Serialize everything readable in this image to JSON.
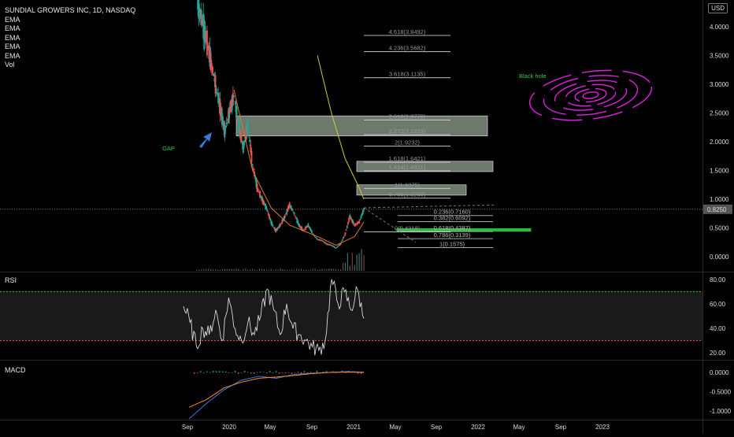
{
  "header": {
    "symbol_title": "SUNDIAL GROWERS INC, 1D, NASDAQ",
    "indicators": [
      "EMA",
      "EMA",
      "EMA",
      "EMA",
      "EMA",
      "Vol"
    ],
    "currency_button": "USD"
  },
  "panels": {
    "rsi_label": "RSI",
    "macd_label": "MACD"
  },
  "annotations": {
    "gap_label": "GAP",
    "black_hole_label": "Black hole",
    "last_price_tag": "0.8250"
  },
  "colors": {
    "background": "#000000",
    "candle_up": "#26a69a",
    "candle_down": "#ef5350",
    "ema_slow": "#cccc33",
    "ema_fast": "#e07a2e",
    "rsi_line": "#d8d8d8",
    "macd_line": "#3b6fd6",
    "signal_line": "#ff8c2a",
    "fib_line": "#cfcfcf",
    "zone_fill": "#c8dcc8",
    "green_zone": "#2ecc40",
    "spiral": "#e020e0",
    "arrow": "#3a7bd5"
  },
  "chart_data": [
    {
      "type": "candlestick",
      "title": "SUNDIAL GROWERS INC, 1D, NASDAQ",
      "x_ticks": [
        "Sep",
        "2020",
        "May",
        "Sep",
        "2021",
        "May",
        "Sep",
        "2022",
        "May",
        "Sep",
        "2023"
      ],
      "y_ticks": [
        "4.0000",
        "3.5000",
        "3.0000",
        "2.5000",
        "2.0000",
        "1.5000",
        "1.0000",
        "0.5000",
        "0.0000"
      ],
      "ylim": [
        -0.1,
        4.5
      ],
      "close_series": [
        {
          "t": 0.0,
          "v": 4.5
        },
        {
          "t": 1.0,
          "v": 3.8
        },
        {
          "t": 2.0,
          "v": 3.0
        },
        {
          "t": 3.0,
          "v": 2.2
        },
        {
          "t": 3.5,
          "v": 2.5
        },
        {
          "t": 4.0,
          "v": 2.8
        },
        {
          "t": 4.5,
          "v": 2.3
        },
        {
          "t": 5.0,
          "v": 1.9
        },
        {
          "t": 5.5,
          "v": 2.3
        },
        {
          "t": 6.0,
          "v": 1.6
        },
        {
          "t": 6.5,
          "v": 1.2
        },
        {
          "t": 7.0,
          "v": 1.0
        },
        {
          "t": 7.5,
          "v": 0.85
        },
        {
          "t": 8.0,
          "v": 0.6
        },
        {
          "t": 8.5,
          "v": 0.45
        },
        {
          "t": 9.0,
          "v": 0.55
        },
        {
          "t": 9.5,
          "v": 0.7
        },
        {
          "t": 10.0,
          "v": 0.9
        },
        {
          "t": 10.5,
          "v": 0.75
        },
        {
          "t": 11.0,
          "v": 0.55
        },
        {
          "t": 11.5,
          "v": 0.45
        },
        {
          "t": 12.0,
          "v": 0.55
        },
        {
          "t": 12.5,
          "v": 0.4
        },
        {
          "t": 13.0,
          "v": 0.3
        },
        {
          "t": 13.5,
          "v": 0.28
        },
        {
          "t": 14.0,
          "v": 0.22
        },
        {
          "t": 14.5,
          "v": 0.2
        },
        {
          "t": 15.0,
          "v": 0.15
        },
        {
          "t": 15.5,
          "v": 0.22
        },
        {
          "t": 16.0,
          "v": 0.4
        },
        {
          "t": 16.5,
          "v": 0.7
        },
        {
          "t": 17.0,
          "v": 0.55
        },
        {
          "t": 17.5,
          "v": 0.6
        },
        {
          "t": 18.0,
          "v": 0.825
        }
      ],
      "ema_slow": [
        {
          "t": 4.0,
          "v": 2.9
        },
        {
          "t": 6.0,
          "v": 1.5
        },
        {
          "t": 8.0,
          "v": 0.85
        },
        {
          "t": 10.0,
          "v": 0.55
        },
        {
          "t": 13.0,
          "v": 0.35
        },
        {
          "t": 15.0,
          "v": 0.2
        },
        {
          "t": 17.0,
          "v": 0.35
        },
        {
          "t": 18.0,
          "v": 0.6
        }
      ],
      "ema_projection": [
        {
          "t": 13.0,
          "v": 3.5
        },
        {
          "t": 14.5,
          "v": 2.5
        },
        {
          "t": 16.0,
          "v": 1.7
        },
        {
          "t": 17.5,
          "v": 1.2
        },
        {
          "t": 18.0,
          "v": 1.0
        }
      ],
      "fib_extension_levels": [
        {
          "label": "4.618(3.8492)",
          "value": 3.8492
        },
        {
          "label": "4.236(3.5682)",
          "value": 3.5682
        },
        {
          "label": "3.618(3.1135)",
          "value": 3.1135
        },
        {
          "label": "2.618(2.3778)",
          "value": 2.3778
        },
        {
          "label": "2.272(2.1233)",
          "value": 2.1233
        },
        {
          "label": "2(1.9232)",
          "value": 1.9232
        },
        {
          "label": "1.618(1.6421)",
          "value": 1.6421
        },
        {
          "label": "1.414(1.4921)",
          "value": 1.4921
        },
        {
          "label": "1(1.1875)",
          "value": 1.1875
        },
        {
          "label": "0.786(1.0200)",
          "value": 1.02
        },
        {
          "label": "0(0.4318)",
          "value": 0.4318
        }
      ],
      "fib_retracement_levels": [
        {
          "label": "0.236(0.7160)",
          "value": 0.716
        },
        {
          "label": "0.382(0.6092)",
          "value": 0.6092
        },
        {
          "label": "0.618(0.4387)",
          "value": 0.4387
        },
        {
          "label": "0.786(0.3139)",
          "value": 0.3139
        },
        {
          "label": "1(0.1575)",
          "value": 0.1575
        }
      ],
      "zones": [
        {
          "y_low": 2.1,
          "y_high": 2.45
        },
        {
          "y_low": 1.48,
          "y_high": 1.66
        },
        {
          "y_low": 1.07,
          "y_high": 1.25
        },
        {
          "y_low": 0.44,
          "y_high": 0.49
        }
      ],
      "last_price": 0.825
    },
    {
      "type": "line",
      "title": "RSI",
      "y_ticks": [
        "80.00",
        "60.00",
        "40.00",
        "20.00"
      ],
      "ylim": [
        15,
        85
      ],
      "bands": [
        70,
        30
      ],
      "values": [
        {
          "t": 0,
          "v": 58
        },
        {
          "t": 1,
          "v": 45
        },
        {
          "t": 2,
          "v": 25
        },
        {
          "t": 3,
          "v": 40
        },
        {
          "t": 4,
          "v": 35
        },
        {
          "t": 5,
          "v": 55
        },
        {
          "t": 6,
          "v": 30
        },
        {
          "t": 7,
          "v": 65
        },
        {
          "t": 8,
          "v": 40
        },
        {
          "t": 9,
          "v": 30
        },
        {
          "t": 10,
          "v": 45
        },
        {
          "t": 11,
          "v": 35
        },
        {
          "t": 12,
          "v": 50
        },
        {
          "t": 13,
          "v": 72
        },
        {
          "t": 14,
          "v": 55
        },
        {
          "t": 15,
          "v": 35
        },
        {
          "t": 16,
          "v": 60
        },
        {
          "t": 17,
          "v": 40
        },
        {
          "t": 18,
          "v": 35
        },
        {
          "t": 19,
          "v": 30
        },
        {
          "t": 20,
          "v": 25
        },
        {
          "t": 21,
          "v": 22
        },
        {
          "t": 22,
          "v": 30
        },
        {
          "t": 23,
          "v": 80
        },
        {
          "t": 24,
          "v": 60
        },
        {
          "t": 25,
          "v": 70
        },
        {
          "t": 26,
          "v": 55
        },
        {
          "t": 27,
          "v": 72
        },
        {
          "t": 28,
          "v": 48
        }
      ]
    },
    {
      "type": "line",
      "title": "MACD",
      "y_ticks": [
        "0.0000",
        "-0.5000",
        "-1.0000"
      ],
      "ylim": [
        -1.3,
        0.2
      ],
      "macd": [
        {
          "t": 0,
          "v": -1.2
        },
        {
          "t": 1,
          "v": -0.8
        },
        {
          "t": 2,
          "v": -0.45
        },
        {
          "t": 3,
          "v": -0.2
        },
        {
          "t": 4,
          "v": -0.1
        },
        {
          "t": 5,
          "v": -0.15
        },
        {
          "t": 6,
          "v": -0.05
        },
        {
          "t": 7,
          "v": -0.02
        },
        {
          "t": 8,
          "v": 0.0
        },
        {
          "t": 9,
          "v": 0.02
        },
        {
          "t": 10,
          "v": 0.01
        }
      ],
      "signal": [
        {
          "t": 0,
          "v": -0.9
        },
        {
          "t": 1,
          "v": -0.7
        },
        {
          "t": 2,
          "v": -0.4
        },
        {
          "t": 3,
          "v": -0.25
        },
        {
          "t": 4,
          "v": -0.15
        },
        {
          "t": 5,
          "v": -0.12
        },
        {
          "t": 6,
          "v": -0.08
        },
        {
          "t": 7,
          "v": -0.03
        },
        {
          "t": 8,
          "v": 0.0
        },
        {
          "t": 9,
          "v": 0.01
        },
        {
          "t": 10,
          "v": 0.0
        }
      ]
    }
  ]
}
